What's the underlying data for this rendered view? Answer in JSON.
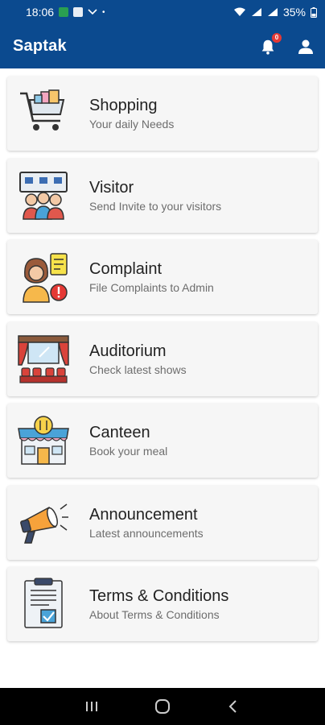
{
  "status_bar": {
    "time": "18:06",
    "battery": "35%"
  },
  "app_bar": {
    "title": "Saptak",
    "notification_count": "0"
  },
  "menu": [
    {
      "title": "Shopping",
      "subtitle": "Your daily Needs",
      "icon": "shopping-cart-icon"
    },
    {
      "title": "Visitor",
      "subtitle": "Send Invite to your visitors",
      "icon": "visitor-group-icon"
    },
    {
      "title": "Complaint",
      "subtitle": "File Complaints to Admin",
      "icon": "complaint-icon"
    },
    {
      "title": "Auditorium",
      "subtitle": "Check latest shows",
      "icon": "auditorium-icon"
    },
    {
      "title": "Canteen",
      "subtitle": "Book your meal",
      "icon": "canteen-icon"
    },
    {
      "title": "Announcement",
      "subtitle": "Latest announcements",
      "icon": "megaphone-icon"
    },
    {
      "title": "Terms & Conditions",
      "subtitle": "About Terms & Conditions",
      "icon": "document-checklist-icon"
    }
  ],
  "colors": {
    "app_bar": "#0b4a8f",
    "card_bg": "#f6f6f6",
    "badge": "#e53935"
  }
}
